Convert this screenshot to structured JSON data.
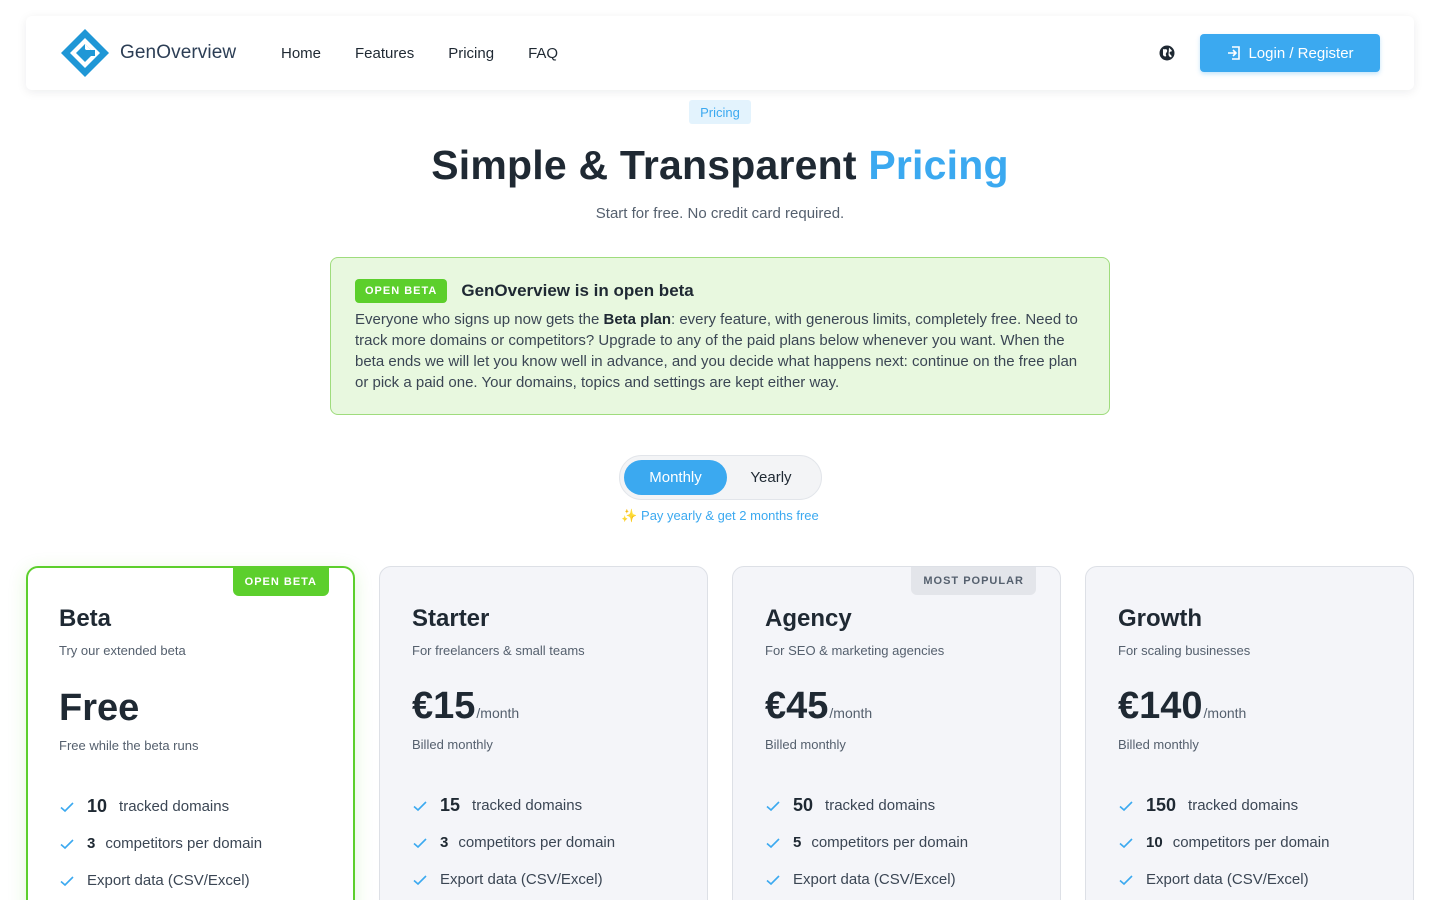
{
  "header": {
    "brand_name": "GenOverview",
    "nav": [
      "Home",
      "Features",
      "Pricing",
      "FAQ"
    ],
    "login_label": "Login / Register"
  },
  "hero": {
    "badge": "Pricing",
    "title_main": "Simple & Transparent ",
    "title_accent": "Pricing",
    "subtitle": "Start for free. No credit card required."
  },
  "beta_notice": {
    "pill": "OPEN BETA",
    "title": "GenOverview is in open beta",
    "body_before": "Everyone who signs up now gets the ",
    "body_bold": "Beta plan",
    "body_after": ": every feature, with generous limits, completely free. Need to track more domains or competitors? Upgrade to any of the paid plans below whenever you want. When the beta ends we will let you know well in advance, and you decide what happens next: continue on the free plan or pick a paid one. Your domains, topics and settings are kept either way."
  },
  "billing": {
    "monthly": "Monthly",
    "yearly": "Yearly",
    "selected": "Monthly",
    "note": "✨ Pay yearly & get 2 months free"
  },
  "plans": [
    {
      "badge": "OPEN BETA",
      "name": "Beta",
      "description": "Try our extended beta",
      "price": "Free",
      "period": "",
      "billing": "Free while the beta runs",
      "features": [
        {
          "num": "10",
          "text": "tracked domains"
        },
        {
          "num": "3",
          "text": "competitors per domain"
        },
        {
          "num": "",
          "text": "Export data (CSV/Excel)"
        }
      ]
    },
    {
      "badge": "",
      "name": "Starter",
      "description": "For freelancers & small teams",
      "price": "€15",
      "period": "/month",
      "billing": "Billed monthly",
      "features": [
        {
          "num": "15",
          "text": "tracked domains"
        },
        {
          "num": "3",
          "text": "competitors per domain"
        },
        {
          "num": "",
          "text": "Export data (CSV/Excel)"
        }
      ]
    },
    {
      "badge": "MOST POPULAR",
      "name": "Agency",
      "description": "For SEO & marketing agencies",
      "price": "€45",
      "period": "/month",
      "billing": "Billed monthly",
      "features": [
        {
          "num": "50",
          "text": "tracked domains"
        },
        {
          "num": "5",
          "text": "competitors per domain"
        },
        {
          "num": "",
          "text": "Export data (CSV/Excel)"
        }
      ]
    },
    {
      "badge": "",
      "name": "Growth",
      "description": "For scaling businesses",
      "price": "€140",
      "period": "/month",
      "billing": "Billed monthly",
      "features": [
        {
          "num": "150",
          "text": "tracked domains"
        },
        {
          "num": "10",
          "text": "competitors per domain"
        },
        {
          "num": "",
          "text": "Export data (CSV/Excel)"
        }
      ]
    }
  ],
  "colors": {
    "accent": "#3ba9f0",
    "beta_green": "#5ccf2c",
    "beta_bg": "#e8f8df",
    "text_dark": "#1f2933",
    "text_muted": "#55606e"
  },
  "icons": {
    "logo": "genoverview-logo-icon",
    "language": "globe-icon",
    "login": "login-icon",
    "feature": "check-icon"
  }
}
